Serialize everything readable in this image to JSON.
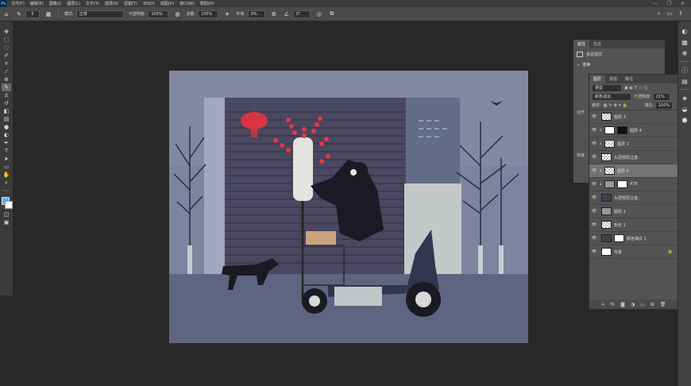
{
  "app": {
    "logo": "Ps"
  },
  "menu": [
    "文件(F)",
    "编辑(E)",
    "图像(I)",
    "图层(L)",
    "文字(Y)",
    "选择(S)",
    "滤镜(T)",
    "3D(D)",
    "视图(V)",
    "窗口(W)",
    "帮助(H)"
  ],
  "window_controls": [
    "—",
    "❐",
    "✕"
  ],
  "options": {
    "mode_label": "模式:",
    "mode_value": "正常",
    "opacity_label": "不透明度:",
    "opacity_value": "100%",
    "flow_label": "流量:",
    "flow_value": "100%",
    "smooth_label": "平滑:",
    "smooth_value": "0%",
    "angle_value": "0°",
    "size_value": "5"
  },
  "tools": [
    "move-tool",
    "marquee-tool",
    "lasso-tool",
    "quick-select-tool",
    "crop-tool",
    "eyedropper-tool",
    "healing-tool",
    "brush-tool",
    "stamp-tool",
    "history-brush-tool",
    "eraser-tool",
    "gradient-tool",
    "blur-tool",
    "dodge-tool",
    "pen-tool",
    "type-tool",
    "path-select-tool",
    "rectangle-tool",
    "hand-tool",
    "zoom-tool",
    "more-tools"
  ],
  "properties_panel": {
    "tabs": [
      "属性",
      "信息"
    ],
    "item": "像素图层",
    "section_transform": "变换",
    "section_align": "对齐",
    "section_quick": "快速"
  },
  "layers_panel": {
    "tabs": [
      "图层",
      "通道",
      "路径"
    ],
    "kind_label": "类型",
    "blend_mode": "颜色减淡",
    "opacity_label": "不透明度:",
    "opacity_value": "21%",
    "lock_label": "锁定:",
    "fill_label": "填充:",
    "fill_value": "100%",
    "layers": [
      {
        "name": "图层 3",
        "thumb": "checker",
        "mask": "",
        "selected": false,
        "clip": false
      },
      {
        "name": "图层 4",
        "thumb": "white",
        "mask": "black",
        "selected": false,
        "clip": true
      },
      {
        "name": "图层 2",
        "thumb": "checker",
        "mask": "",
        "selected": false,
        "clip": true
      },
      {
        "name": "头层部层过渡..",
        "thumb": "checker",
        "mask": "",
        "selected": false,
        "clip": false
      },
      {
        "name": "图层 5",
        "thumb": "checker",
        "mask": "",
        "selected": true,
        "clip": true
      },
      {
        "name": "478",
        "thumb": "gray",
        "mask": "white",
        "selected": false,
        "clip": true
      },
      {
        "name": "头层部层过渡..",
        "thumb": "dark",
        "mask": "",
        "selected": false,
        "clip": false
      },
      {
        "name": "图层 1",
        "thumb": "gray",
        "mask": "",
        "selected": false,
        "clip": false
      },
      {
        "name": "矩形 1",
        "thumb": "checker",
        "mask": "",
        "selected": false,
        "clip": false
      },
      {
        "name": "颜色填充 1",
        "thumb": "dark",
        "mask": "white",
        "selected": false,
        "clip": false
      },
      {
        "name": "背景",
        "thumb": "white",
        "mask": "",
        "selected": false,
        "clip": false
      }
    ],
    "footer_icons": [
      "link-icon",
      "fx-icon",
      "mask-icon",
      "adjustment-icon",
      "folder-icon",
      "new-layer-icon",
      "trash-icon"
    ]
  },
  "colors": {
    "accent": "#31a8ff",
    "canvas_bg": "#7d849f",
    "lantern": "#d9343f"
  }
}
